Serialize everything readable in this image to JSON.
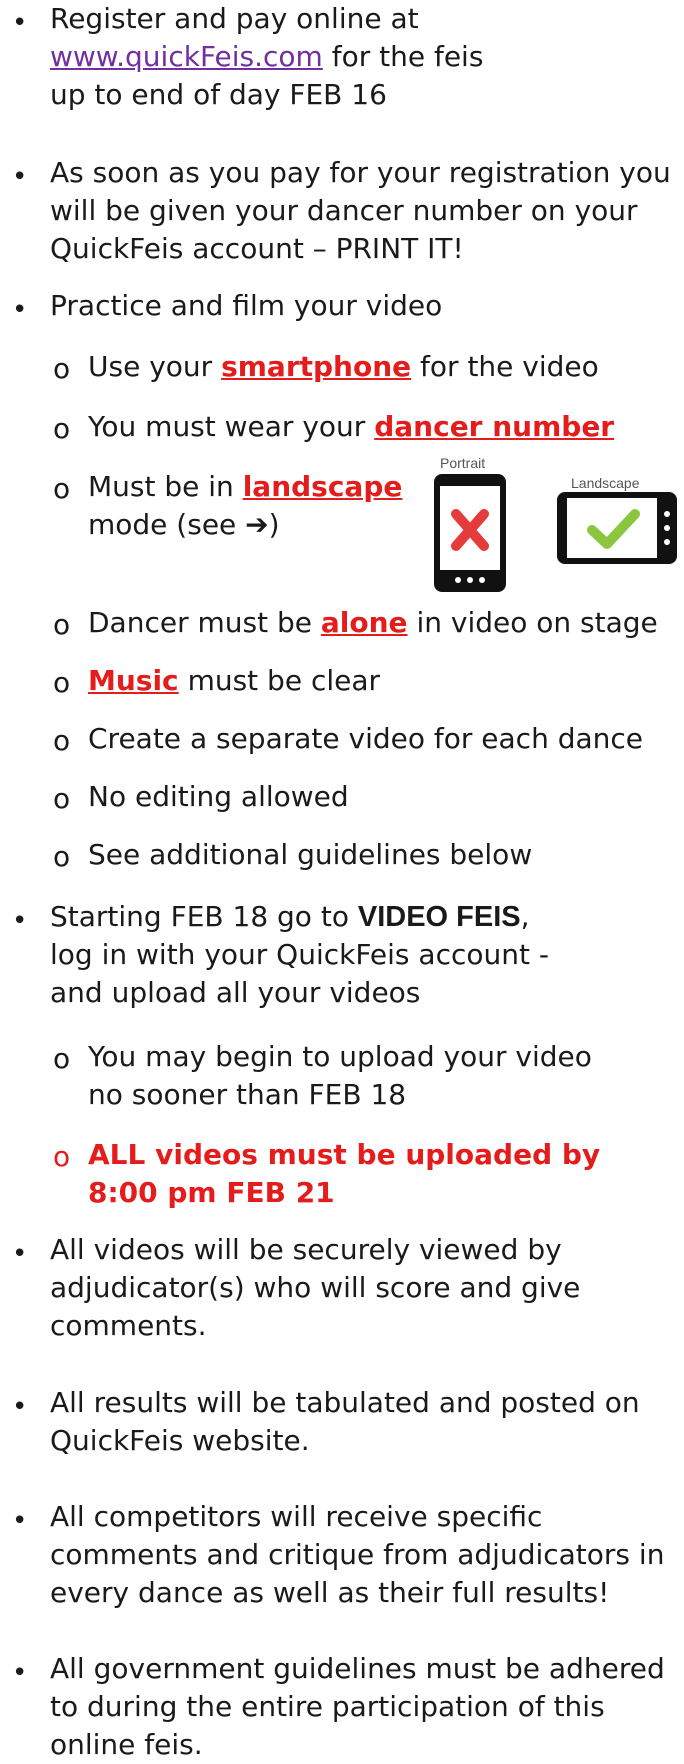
{
  "items": [
    {
      "a": "Register and pay online at",
      "link": "www.quickFeis.com",
      "b": " for the feis",
      "c": "up to end of day FEB 16"
    },
    {
      "a": "As soon as you pay for your registration you",
      "b": "will be given your dancer number on your",
      "c": "QuickFeis account – PRINT IT!"
    },
    {
      "a": "Practice and film your video"
    },
    {
      "a": "Starting FEB 18 go to ",
      "bold": "VIDEO FEIS",
      "b": ",",
      "c": "log in with your QuickFeis account -",
      "d": "and upload all your videos"
    },
    {
      "a": "All videos will be securely viewed by",
      "b": "adjudicator(s) who will score and give",
      "c": "comments."
    },
    {
      "a": "All results will be tabulated and posted on",
      "b": "QuickFeis website."
    },
    {
      "a": "All competitors will receive specific",
      "b": "comments and critique from adjudicators in",
      "c": "every dance as well as their full results!"
    },
    {
      "a": "All government guidelines must be adhered",
      "b": "to during the entire participation of this",
      "c": "online feis."
    }
  ],
  "subs": {
    "s1": {
      "a": "Use your ",
      "red": "smartphone",
      "b": " for the video"
    },
    "s2": {
      "a": "You must wear your ",
      "red": "dancer number"
    },
    "s3": {
      "a": "Must be in ",
      "red": "landscape",
      "b": "mode (see ",
      "arrow": "➔",
      "c": ")"
    },
    "s4": {
      "a": "Dancer must be ",
      "red": "alone",
      "b": " in video on stage"
    },
    "s5": {
      "red": "Music",
      "b": " must be clear"
    },
    "s6": {
      "a": "Create a separate video for each dance"
    },
    "s7": {
      "a": "No editing allowed"
    },
    "s8": {
      "a": "See additional guidelines below"
    },
    "s9": {
      "a": "You may begin to upload your video",
      "b": "no sooner than FEB 18"
    },
    "s10": {
      "a": "ALL videos must be uploaded by",
      "b": "8:00 pm FEB 21"
    }
  },
  "images": {
    "portrait": "Portrait",
    "landscape": "Landscape"
  },
  "bullet": "•",
  "circle": "o"
}
